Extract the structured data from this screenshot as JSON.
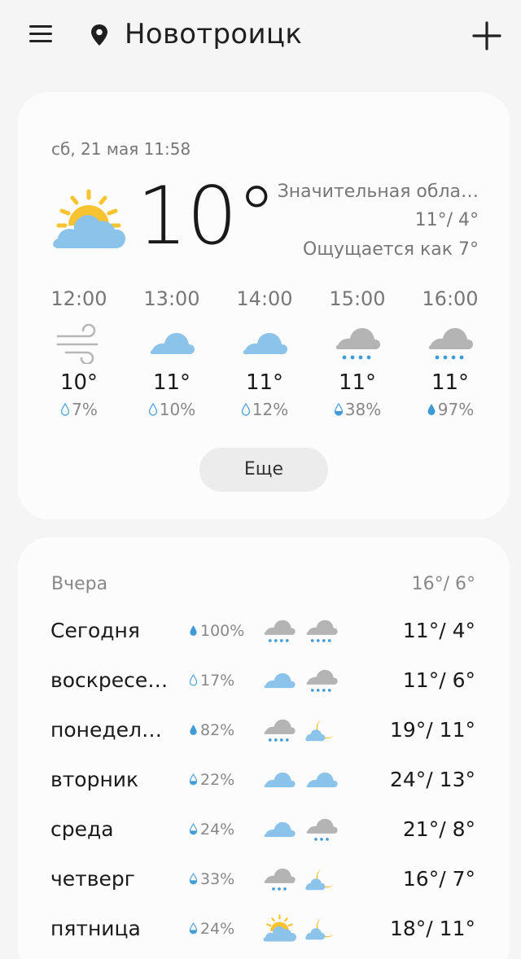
{
  "header": {
    "city": "Новотроицк"
  },
  "current": {
    "date": "сб, 21 мая 11:58",
    "temp": "10°",
    "description": "Значительная обла…",
    "hilo": "11°/ 4°",
    "feels_like": "Ощущается как 7°",
    "icon": "partly-sunny-icon"
  },
  "hourly": [
    {
      "time": "12:00",
      "temp": "10°",
      "precip": "7%",
      "icon": "wind-icon"
    },
    {
      "time": "13:00",
      "temp": "11°",
      "precip": "10%",
      "icon": "cloud-icon"
    },
    {
      "time": "14:00",
      "temp": "11°",
      "precip": "12%",
      "icon": "cloud-icon"
    },
    {
      "time": "15:00",
      "temp": "11°",
      "precip": "38%",
      "icon": "rain-cloud-icon"
    },
    {
      "time": "16:00",
      "temp": "11°",
      "precip": "97%",
      "icon": "rain-cloud-icon"
    }
  ],
  "more_label": "Еще",
  "daily": {
    "yesterday_label": "Вчера",
    "yesterday_temps": "16°/ 6°",
    "days": [
      {
        "name": "Сегодня",
        "precip": "100%",
        "temps": "11°/ 4°",
        "day_icon": "rain-cloud-icon",
        "night_icon": "rain-cloud-icon"
      },
      {
        "name": "воскресе…",
        "precip": "17%",
        "temps": "11°/ 6°",
        "day_icon": "cloud-icon",
        "night_icon": "rain-cloud-icon"
      },
      {
        "name": "понедел…",
        "precip": "82%",
        "temps": "19°/ 11°",
        "day_icon": "rain-cloud-icon",
        "night_icon": "moon-cloud-icon"
      },
      {
        "name": "вторник",
        "precip": "22%",
        "temps": "24°/ 13°",
        "day_icon": "cloud-icon",
        "night_icon": "cloud-icon"
      },
      {
        "name": "среда",
        "precip": "24%",
        "temps": "21°/ 8°",
        "day_icon": "cloud-icon",
        "night_icon": "rain-cloud-icon"
      },
      {
        "name": "четверг",
        "precip": "33%",
        "temps": "16°/ 7°",
        "day_icon": "rain-cloud-icon",
        "night_icon": "moon-cloud-icon"
      },
      {
        "name": "пятница",
        "precip": "24%",
        "temps": "18°/ 11°",
        "day_icon": "partly-sunny-icon",
        "night_icon": "moon-cloud-icon"
      }
    ]
  },
  "colors": {
    "cloud_blue": "#8cc3ea",
    "rain_cloud_gray": "#b4b4b4",
    "sun_yellow": "#f7c331",
    "drop_blue": "#3f9ad6",
    "background": "#f5f5f5"
  }
}
